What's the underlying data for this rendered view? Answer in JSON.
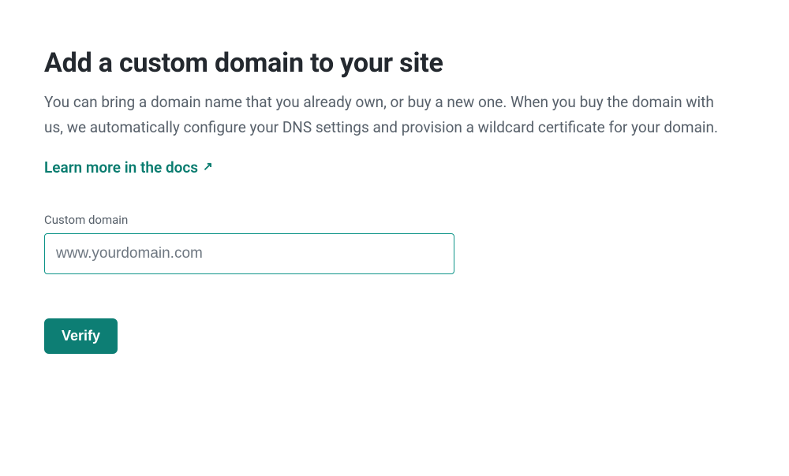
{
  "heading": "Add a custom domain to your site",
  "description": "You can bring a domain name that you already own, or buy a new one. When you buy the domain with us, we automatically configure your DNS settings and provision a wildcard certificate for your domain.",
  "docs_link": {
    "label": "Learn more in the docs",
    "icon_glyph": "↗"
  },
  "form": {
    "field_label": "Custom domain",
    "input_placeholder": "www.yourdomain.com",
    "input_value": "",
    "verify_label": "Verify"
  },
  "colors": {
    "accent": "#0D9488",
    "button": "#0D7E74",
    "text_muted": "#57606a"
  }
}
